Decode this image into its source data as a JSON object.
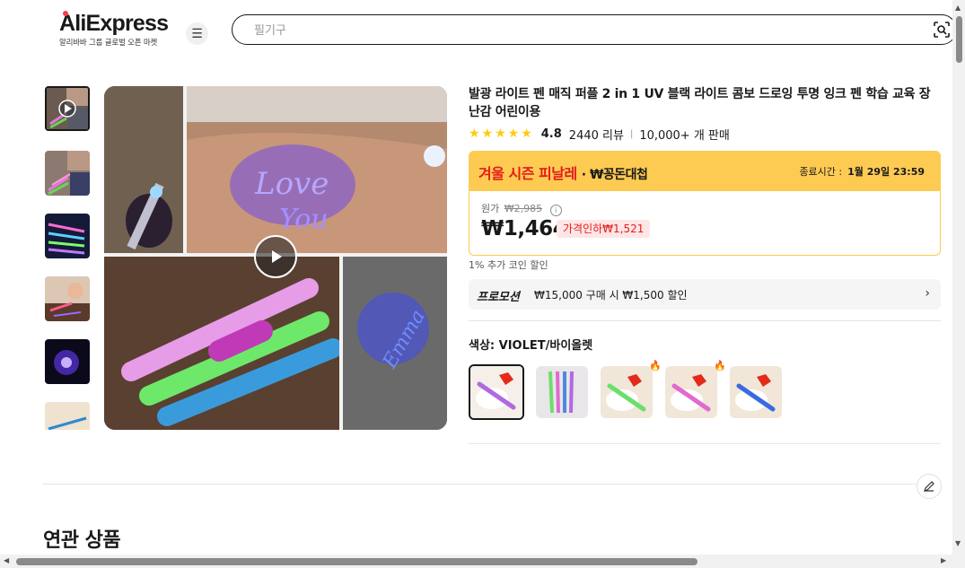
{
  "header": {
    "logo": "AliExpress",
    "logo_sub": "알리바바 그룹 글로벌 오픈 마켓",
    "search_placeholder": "필기구"
  },
  "product": {
    "title": "발광 라이트 펜 매직 퍼플 2 in 1 UV 블랙 라이트 콤보 드로잉 투명 잉크 펜 학습 교육 장난감 어린이용",
    "rating": "4.8",
    "reviews": "2440 리뷰",
    "sold": "10,000+ 개 판매",
    "rating_value": 4.8
  },
  "sale_banner": {
    "title": "겨울 시즌 피날레",
    "subtitle": "· ₩꽁돈대첩",
    "end_label": "종료시간 :",
    "end_time": "1월 29일 23:59"
  },
  "price": {
    "original_label": "원가",
    "original": "₩2,985",
    "current": "₩1,464",
    "discount": "가격인하₩1,521"
  },
  "coin_text": "1% 추가 코인 할인",
  "promotion": {
    "label": "프로모션",
    "text": "₩15,000 구매 시 ₩1,500 할인"
  },
  "color": {
    "label": "색상: VIOLET/바이올렛"
  },
  "related_title": "연관 상품",
  "image_text": {
    "love": "Love",
    "you": "You",
    "emma": "Emma"
  },
  "icons": {
    "menu": "menu-icon",
    "search": "image-search-icon",
    "play": "play-icon",
    "info": "info-icon",
    "arrow": "chevron-right-icon",
    "fire": "fire-icon",
    "edit": "pencil-icon"
  },
  "colors": {
    "accent_red": "#e31c1c",
    "banner_yellow": "#fdcb52",
    "star": "#fdcc0d"
  }
}
